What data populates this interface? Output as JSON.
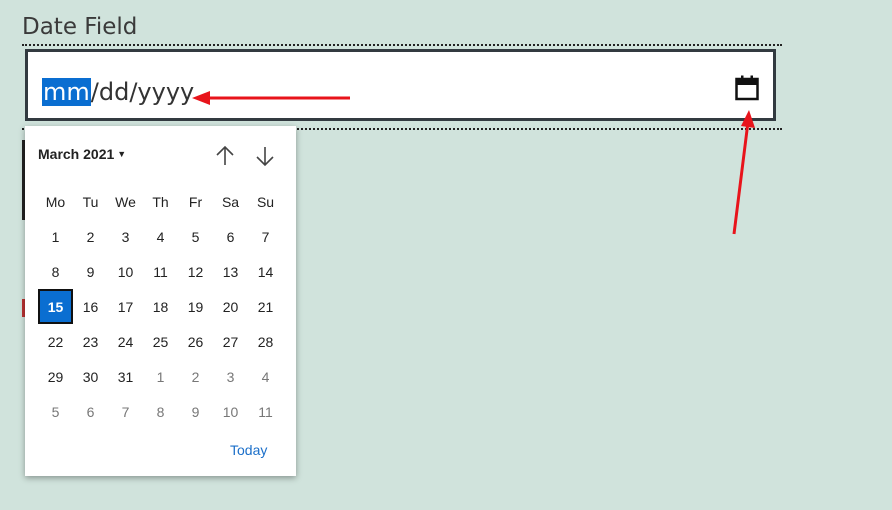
{
  "field": {
    "label": "Date Field",
    "segment_month": "mm",
    "segment_rest": "/dd/yyyy"
  },
  "icons": {
    "calendar": "calendar-icon",
    "up": "arrow-up-icon",
    "down": "arrow-down-icon",
    "caret": "caret-down-icon"
  },
  "calendar": {
    "month_label": "March 2021",
    "weekdays": [
      "Mo",
      "Tu",
      "We",
      "Th",
      "Fr",
      "Sa",
      "Su"
    ],
    "weeks": [
      [
        "1",
        "2",
        "3",
        "4",
        "5",
        "6",
        "7"
      ],
      [
        "8",
        "9",
        "10",
        "11",
        "12",
        "13",
        "14"
      ],
      [
        "15",
        "16",
        "17",
        "18",
        "19",
        "20",
        "21"
      ],
      [
        "22",
        "23",
        "24",
        "25",
        "26",
        "27",
        "28"
      ],
      [
        "29",
        "30",
        "31",
        "1",
        "2",
        "3",
        "4"
      ],
      [
        "5",
        "6",
        "7",
        "8",
        "9",
        "10",
        "11"
      ]
    ],
    "selected_day": "15",
    "today_label": "Today"
  },
  "colors": {
    "background": "#d0e3dc",
    "accent": "#0a6ed1",
    "annotation_arrow": "#e8141b",
    "link": "#1b6fc9"
  }
}
